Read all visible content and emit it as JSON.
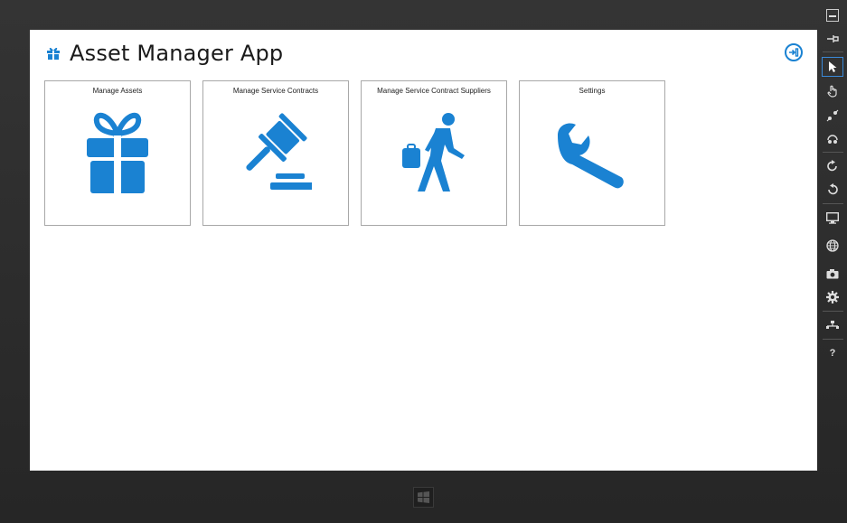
{
  "app": {
    "title": "Asset Manager App",
    "accent": "#1a82d2"
  },
  "tiles": [
    {
      "label": "Manage Assets",
      "icon": "gift-icon"
    },
    {
      "label": "Manage Service Contracts",
      "icon": "gavel-icon"
    },
    {
      "label": "Manage Service Contract Suppliers",
      "icon": "walking-person-icon"
    },
    {
      "label": "Settings",
      "icon": "wrench-icon"
    }
  ],
  "sidebar": {
    "items": [
      "minimize-icon",
      "pin-icon",
      "pointer-icon",
      "hand-icon",
      "pinch-icon",
      "rotate-touch-icon",
      "rotate-clockwise-icon",
      "rotate-counterclockwise-icon",
      "monitor-icon",
      "globe-icon",
      "camera-icon",
      "gear-icon",
      "network-icon",
      "help-icon"
    ],
    "help_label": "?"
  },
  "taskbar": {
    "windows_icon": "windows-icon"
  }
}
